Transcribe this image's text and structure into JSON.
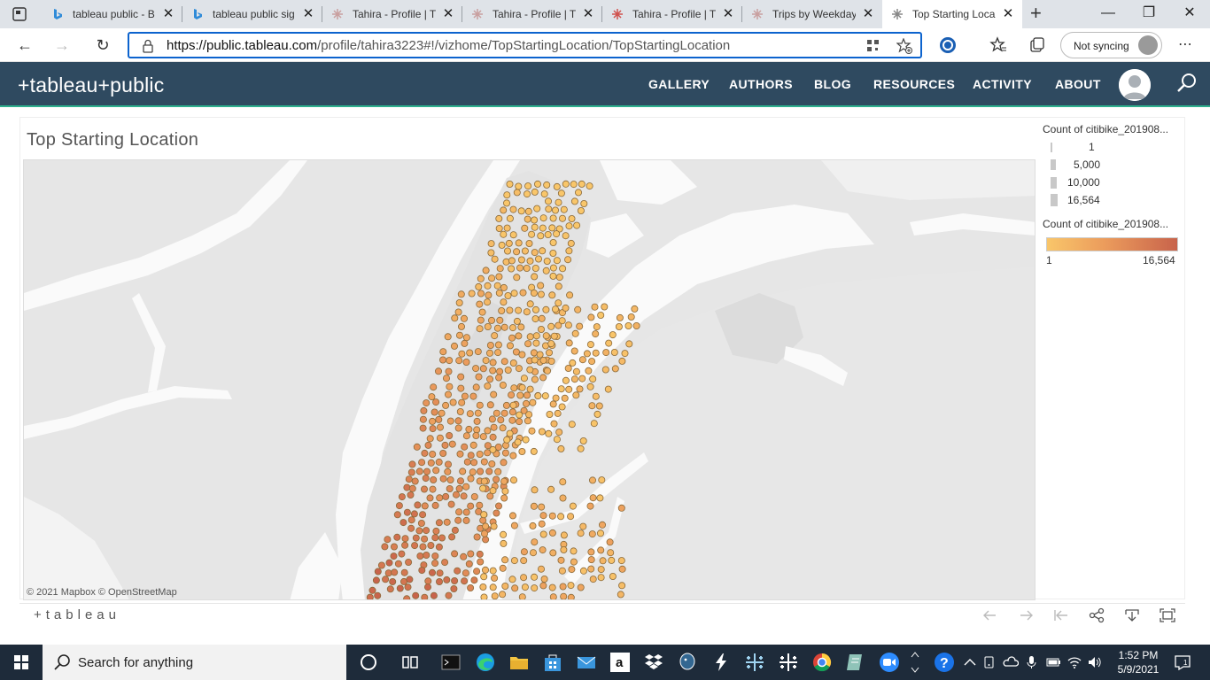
{
  "browser": {
    "tabs": [
      {
        "title": "tableau public - B",
        "icon": "bing-icon"
      },
      {
        "title": "tableau public sig",
        "icon": "bing-icon"
      },
      {
        "title": "Tahira - Profile | T",
        "icon": "tableau-icon"
      },
      {
        "title": "Tahira - Profile | T",
        "icon": "tableau-icon"
      },
      {
        "title": "Tahira - Profile | T",
        "icon": "tableau-icon"
      },
      {
        "title": "Trips by Weekday",
        "icon": "tableau-icon"
      },
      {
        "title": "Top Starting Loca",
        "icon": "tableau-icon"
      }
    ],
    "url_host": "https://public.tableau.com",
    "url_path": "/profile/tahira3223#!/vizhome/TopStartingLocation/TopStartingLocation",
    "sync_label": "Not syncing"
  },
  "site": {
    "logo": "+tableau+public",
    "nav": [
      "GALLERY",
      "AUTHORS",
      "BLOG",
      "RESOURCES",
      "ACTIVITY",
      "ABOUT"
    ]
  },
  "viz": {
    "title": "Top Starting Location",
    "attribution": "© 2021 Mapbox  © OpenStreetMap",
    "toolbar_logo": "+tableau",
    "size_legend": {
      "title": "Count of citibike_201908...",
      "items": [
        "1",
        "5,000",
        "10,000",
        "16,564"
      ]
    },
    "color_legend": {
      "title": "Count of citibike_201908...",
      "min": "1",
      "max": "16,564",
      "colors": [
        "#f9c66a",
        "#eb9b5c",
        "#c8634b"
      ]
    }
  },
  "taskbar": {
    "search_placeholder": "Search for anything",
    "time": "1:52 PM",
    "date": "5/9/2021"
  }
}
